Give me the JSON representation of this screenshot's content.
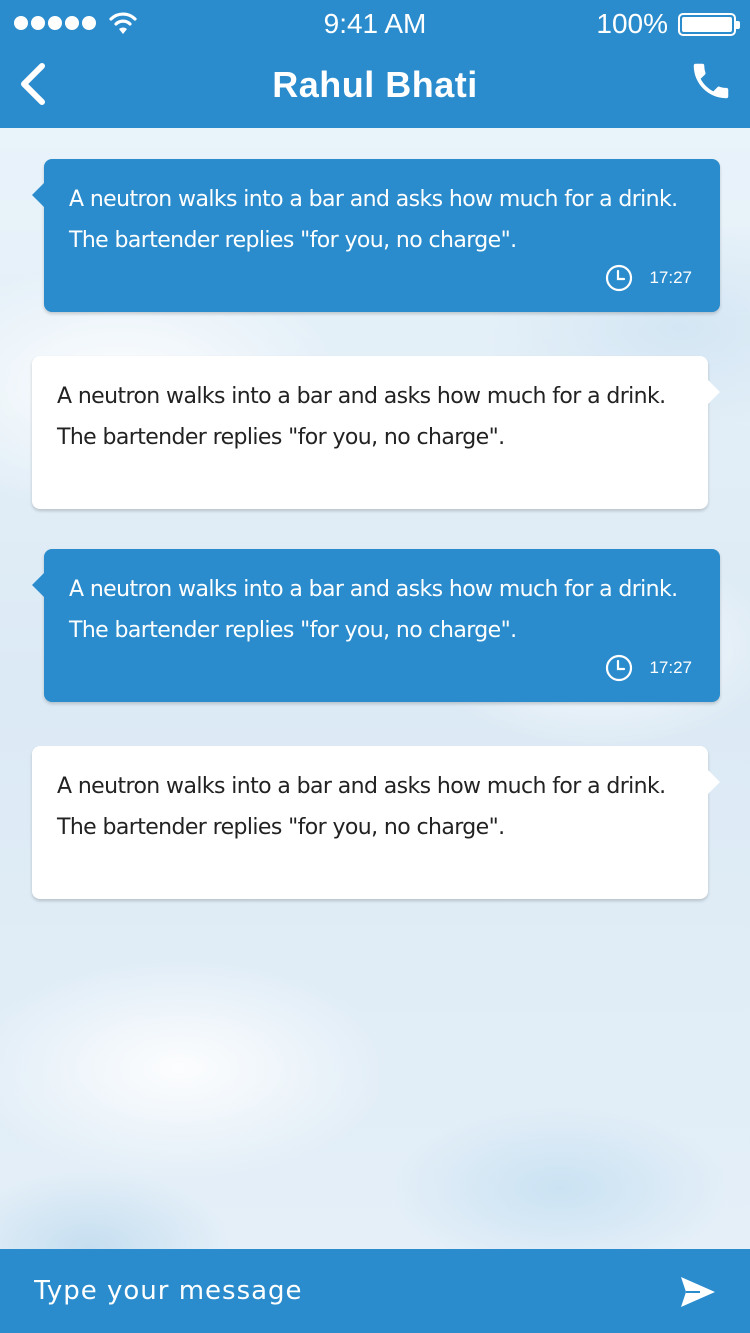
{
  "status_bar": {
    "time": "9:41 AM",
    "battery_percent": "100%",
    "signal_icon": "signal-dots-icon",
    "wifi_icon": "wifi-icon",
    "battery_icon": "battery-icon"
  },
  "header": {
    "title": "Rahul Bhati",
    "back_icon": "chevron-left-icon",
    "call_icon": "phone-icon"
  },
  "messages": [
    {
      "type": "received",
      "text": "A neutron walks into a bar and asks how much for a drink.\nThe bartender replies \"for you, no charge\".",
      "time": "17:27"
    },
    {
      "type": "sent",
      "text": "A neutron walks into a bar and asks how much for a drink.\nThe bartender replies \"for you, no charge\"."
    },
    {
      "type": "received",
      "text": "A neutron walks into a bar and asks how much for a drink.\nThe bartender replies \"for you, no charge\".",
      "time": "17:27"
    },
    {
      "type": "sent",
      "text": "A neutron walks into a bar and asks how much for a drink.\nThe bartender replies \"for you, no charge\"."
    }
  ],
  "composer": {
    "placeholder": "Type your message",
    "value": "",
    "send_icon": "send-icon"
  },
  "colors": {
    "primary": "#2a8ccd",
    "received_bubble": "#2a8ccd",
    "sent_bubble": "#ffffff",
    "text_dark": "#222222"
  }
}
